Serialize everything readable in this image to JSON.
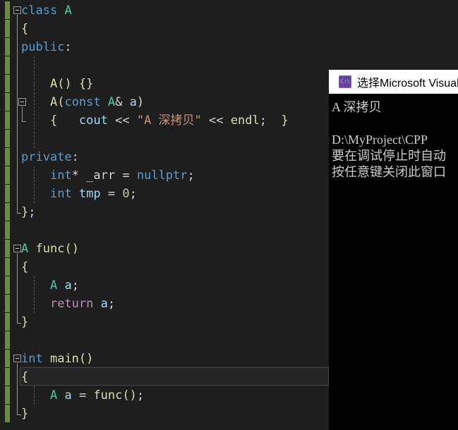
{
  "app": {
    "theme": "visual-studio-dark",
    "editor_background": "#1e1e1e",
    "console_background": "#000000",
    "change_marker_color": "#6a8a3c"
  },
  "editor": {
    "name": "code-editor",
    "language": "cpp",
    "lines": [
      {
        "n": 1,
        "indent": 0,
        "fold": "start",
        "text": "class A",
        "tokens": [
          {
            "t": "class",
            "c": "t-kw"
          },
          {
            "t": " ",
            "c": "t-plain"
          },
          {
            "t": "A",
            "c": "t-type"
          }
        ]
      },
      {
        "n": 2,
        "indent": 0,
        "fold": null,
        "text": "{",
        "tokens": [
          {
            "t": "{",
            "c": "t-brace"
          }
        ]
      },
      {
        "n": 3,
        "indent": 0,
        "fold": null,
        "text": "public:",
        "tokens": [
          {
            "t": "public",
            "c": "t-kw"
          },
          {
            "t": ":",
            "c": "t-plain"
          }
        ]
      },
      {
        "n": 4,
        "indent": 1,
        "fold": null,
        "text": "",
        "tokens": []
      },
      {
        "n": 5,
        "indent": 1,
        "fold": null,
        "text": "    A() {}",
        "tokens": [
          {
            "t": "    ",
            "c": "t-plain"
          },
          {
            "t": "A",
            "c": "t-func"
          },
          {
            "t": "() {}",
            "c": "t-brace"
          }
        ]
      },
      {
        "n": 6,
        "indent": 1,
        "fold": "start",
        "text": "    A(const A& a)",
        "tokens": [
          {
            "t": "    ",
            "c": "t-plain"
          },
          {
            "t": "A",
            "c": "t-func"
          },
          {
            "t": "(",
            "c": "t-brace"
          },
          {
            "t": "const",
            "c": "t-kw"
          },
          {
            "t": " ",
            "c": "t-plain"
          },
          {
            "t": "A",
            "c": "t-type"
          },
          {
            "t": "& ",
            "c": "t-plain"
          },
          {
            "t": "a",
            "c": "t-var"
          },
          {
            "t": ")",
            "c": "t-brace"
          }
        ]
      },
      {
        "n": 7,
        "indent": 1,
        "fold": "end",
        "text": "    {   cout << \"A 深拷贝\" << endl;  }",
        "tokens": [
          {
            "t": "    ",
            "c": "t-plain"
          },
          {
            "t": "{",
            "c": "t-brace"
          },
          {
            "t": "   ",
            "c": "t-plain"
          },
          {
            "t": "cout",
            "c": "t-var"
          },
          {
            "t": " << ",
            "c": "t-plain"
          },
          {
            "t": "\"A 深拷贝\"",
            "c": "t-str"
          },
          {
            "t": " << ",
            "c": "t-plain"
          },
          {
            "t": "endl",
            "c": "t-func"
          },
          {
            "t": ";  ",
            "c": "t-plain"
          },
          {
            "t": "}",
            "c": "t-brace"
          }
        ]
      },
      {
        "n": 8,
        "indent": 1,
        "fold": null,
        "text": "",
        "tokens": []
      },
      {
        "n": 9,
        "indent": 0,
        "fold": null,
        "text": "private:",
        "tokens": [
          {
            "t": "private",
            "c": "t-kw"
          },
          {
            "t": ":",
            "c": "t-plain"
          }
        ]
      },
      {
        "n": 10,
        "indent": 1,
        "fold": null,
        "text": "    int* _arr = nullptr;",
        "tokens": [
          {
            "t": "    ",
            "c": "t-plain"
          },
          {
            "t": "int",
            "c": "t-kw"
          },
          {
            "t": "* ",
            "c": "t-plain"
          },
          {
            "t": "_arr",
            "c": "t-plain"
          },
          {
            "t": " = ",
            "c": "t-plain"
          },
          {
            "t": "nullptr",
            "c": "t-kw"
          },
          {
            "t": ";",
            "c": "t-plain"
          }
        ]
      },
      {
        "n": 11,
        "indent": 1,
        "fold": null,
        "text": "    int tmp = 0;",
        "tokens": [
          {
            "t": "    ",
            "c": "t-plain"
          },
          {
            "t": "int",
            "c": "t-kw"
          },
          {
            "t": " ",
            "c": "t-plain"
          },
          {
            "t": "tmp",
            "c": "t-var"
          },
          {
            "t": " = ",
            "c": "t-plain"
          },
          {
            "t": "0",
            "c": "t-num"
          },
          {
            "t": ";",
            "c": "t-plain"
          }
        ]
      },
      {
        "n": 12,
        "indent": 0,
        "fold": "end",
        "text": "};",
        "tokens": [
          {
            "t": "}",
            "c": "t-brace"
          },
          {
            "t": ";",
            "c": "t-plain"
          }
        ]
      },
      {
        "n": 13,
        "indent": 0,
        "fold": null,
        "text": "",
        "tokens": []
      },
      {
        "n": 14,
        "indent": 0,
        "fold": "start",
        "text": "A func()",
        "tokens": [
          {
            "t": "A",
            "c": "t-type"
          },
          {
            "t": " ",
            "c": "t-plain"
          },
          {
            "t": "func",
            "c": "t-func"
          },
          {
            "t": "()",
            "c": "t-brace"
          }
        ]
      },
      {
        "n": 15,
        "indent": 0,
        "fold": null,
        "text": "{",
        "tokens": [
          {
            "t": "{",
            "c": "t-brace"
          }
        ]
      },
      {
        "n": 16,
        "indent": 1,
        "fold": null,
        "text": "    A a;",
        "tokens": [
          {
            "t": "    ",
            "c": "t-plain"
          },
          {
            "t": "A",
            "c": "t-type"
          },
          {
            "t": " ",
            "c": "t-plain"
          },
          {
            "t": "a",
            "c": "t-var"
          },
          {
            "t": ";",
            "c": "t-plain"
          }
        ]
      },
      {
        "n": 17,
        "indent": 1,
        "fold": null,
        "text": "    return a;",
        "tokens": [
          {
            "t": "    ",
            "c": "t-plain"
          },
          {
            "t": "return",
            "c": "t-ctrl"
          },
          {
            "t": " ",
            "c": "t-plain"
          },
          {
            "t": "a",
            "c": "t-var"
          },
          {
            "t": ";",
            "c": "t-plain"
          }
        ]
      },
      {
        "n": 18,
        "indent": 0,
        "fold": "end",
        "text": "}",
        "tokens": [
          {
            "t": "}",
            "c": "t-brace"
          }
        ]
      },
      {
        "n": 19,
        "indent": 0,
        "fold": null,
        "text": "",
        "tokens": []
      },
      {
        "n": 20,
        "indent": 0,
        "fold": "start",
        "text": "int main()",
        "tokens": [
          {
            "t": "int",
            "c": "t-kw"
          },
          {
            "t": " ",
            "c": "t-plain"
          },
          {
            "t": "main",
            "c": "t-func"
          },
          {
            "t": "()",
            "c": "t-brace"
          }
        ]
      },
      {
        "n": 21,
        "indent": 0,
        "fold": null,
        "text": "{",
        "current": true,
        "tokens": [
          {
            "t": "{",
            "c": "t-brace"
          }
        ]
      },
      {
        "n": 22,
        "indent": 1,
        "fold": null,
        "text": "    A a = func();",
        "tokens": [
          {
            "t": "    ",
            "c": "t-plain"
          },
          {
            "t": "A",
            "c": "t-type"
          },
          {
            "t": " ",
            "c": "t-plain"
          },
          {
            "t": "a",
            "c": "t-var"
          },
          {
            "t": " = ",
            "c": "t-plain"
          },
          {
            "t": "func",
            "c": "t-func"
          },
          {
            "t": "();",
            "c": "t-brace"
          }
        ]
      },
      {
        "n": 23,
        "indent": 0,
        "fold": null,
        "text": "}",
        "tokens": [
          {
            "t": "}",
            "c": "t-brace"
          }
        ]
      }
    ]
  },
  "console": {
    "name": "console-window",
    "title": "选择Microsoft Visual",
    "icon": "cmd-console-icon",
    "icon_label": "C:\\",
    "output_lines": [
      "A 深拷贝",
      "",
      "D:\\MyProject\\CPP ",
      "要在调试停止时自动",
      "按任意键关闭此窗口"
    ]
  }
}
